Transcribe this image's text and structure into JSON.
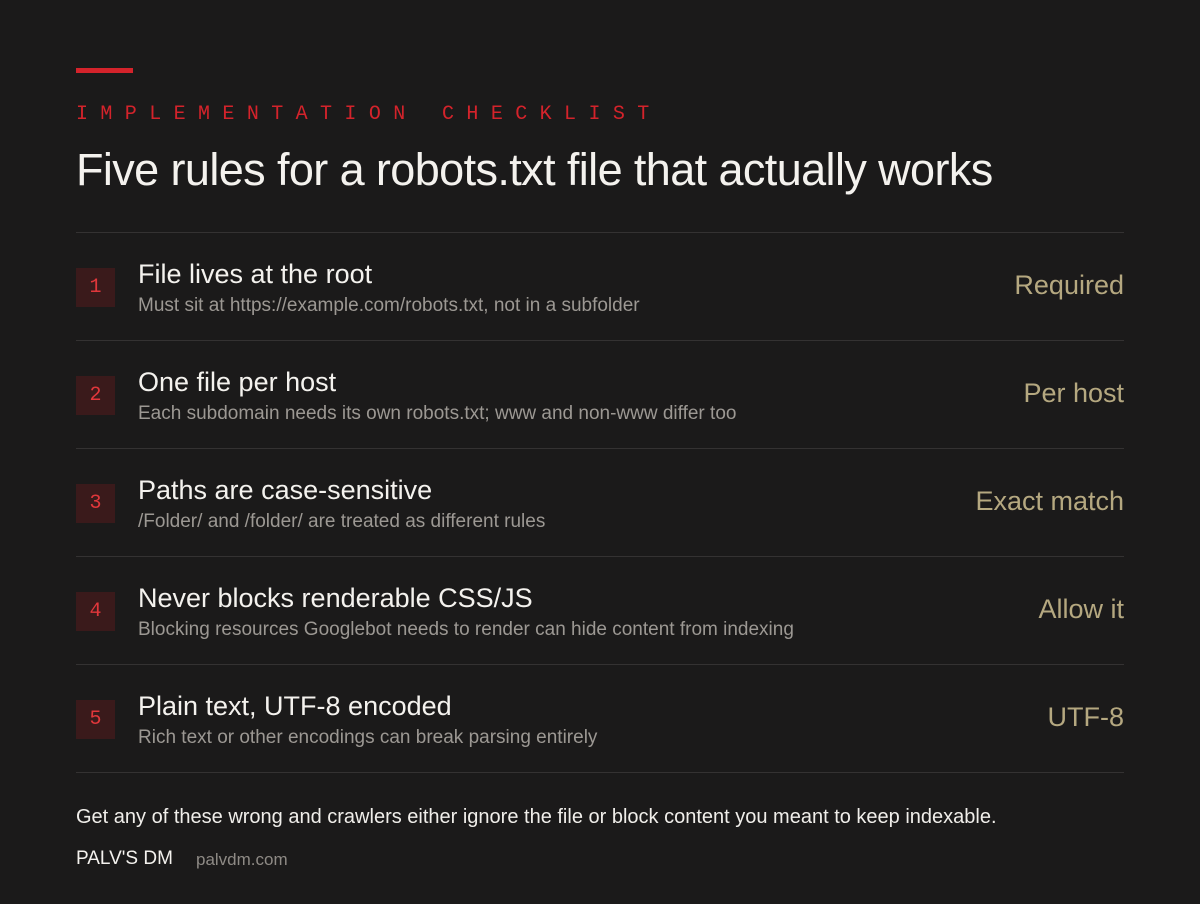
{
  "header": {
    "eyebrow": "IMPLEMENTATION CHECKLIST",
    "title": "Five rules for a robots.txt file that actually works"
  },
  "rules": [
    {
      "number": "1",
      "title": "File lives at the root",
      "description": "Must sit at https://example.com/robots.txt, not in a subfolder",
      "tag": "Required"
    },
    {
      "number": "2",
      "title": "One file per host",
      "description": "Each subdomain needs its own robots.txt; www and non-www differ too",
      "tag": "Per host"
    },
    {
      "number": "3",
      "title": "Paths are case-sensitive",
      "description": "/Folder/ and /folder/ are treated as different rules",
      "tag": "Exact match"
    },
    {
      "number": "4",
      "title": "Never blocks renderable CSS/JS",
      "description": "Blocking resources Googlebot needs to render can hide content from indexing",
      "tag": "Allow it"
    },
    {
      "number": "5",
      "title": "Plain text, UTF-8 encoded",
      "description": "Rich text or other encodings can break parsing entirely",
      "tag": "UTF-8"
    }
  ],
  "footer": {
    "note": "Get any of these wrong and crawlers either ignore the file or block content you meant to keep indexable.",
    "brand": "PALV'S DM",
    "site": "palvdm.com"
  },
  "colors": {
    "background": "#1b1a1a",
    "accent": "#d4232b",
    "tag": "#b5a880",
    "muted": "#9c9893"
  }
}
